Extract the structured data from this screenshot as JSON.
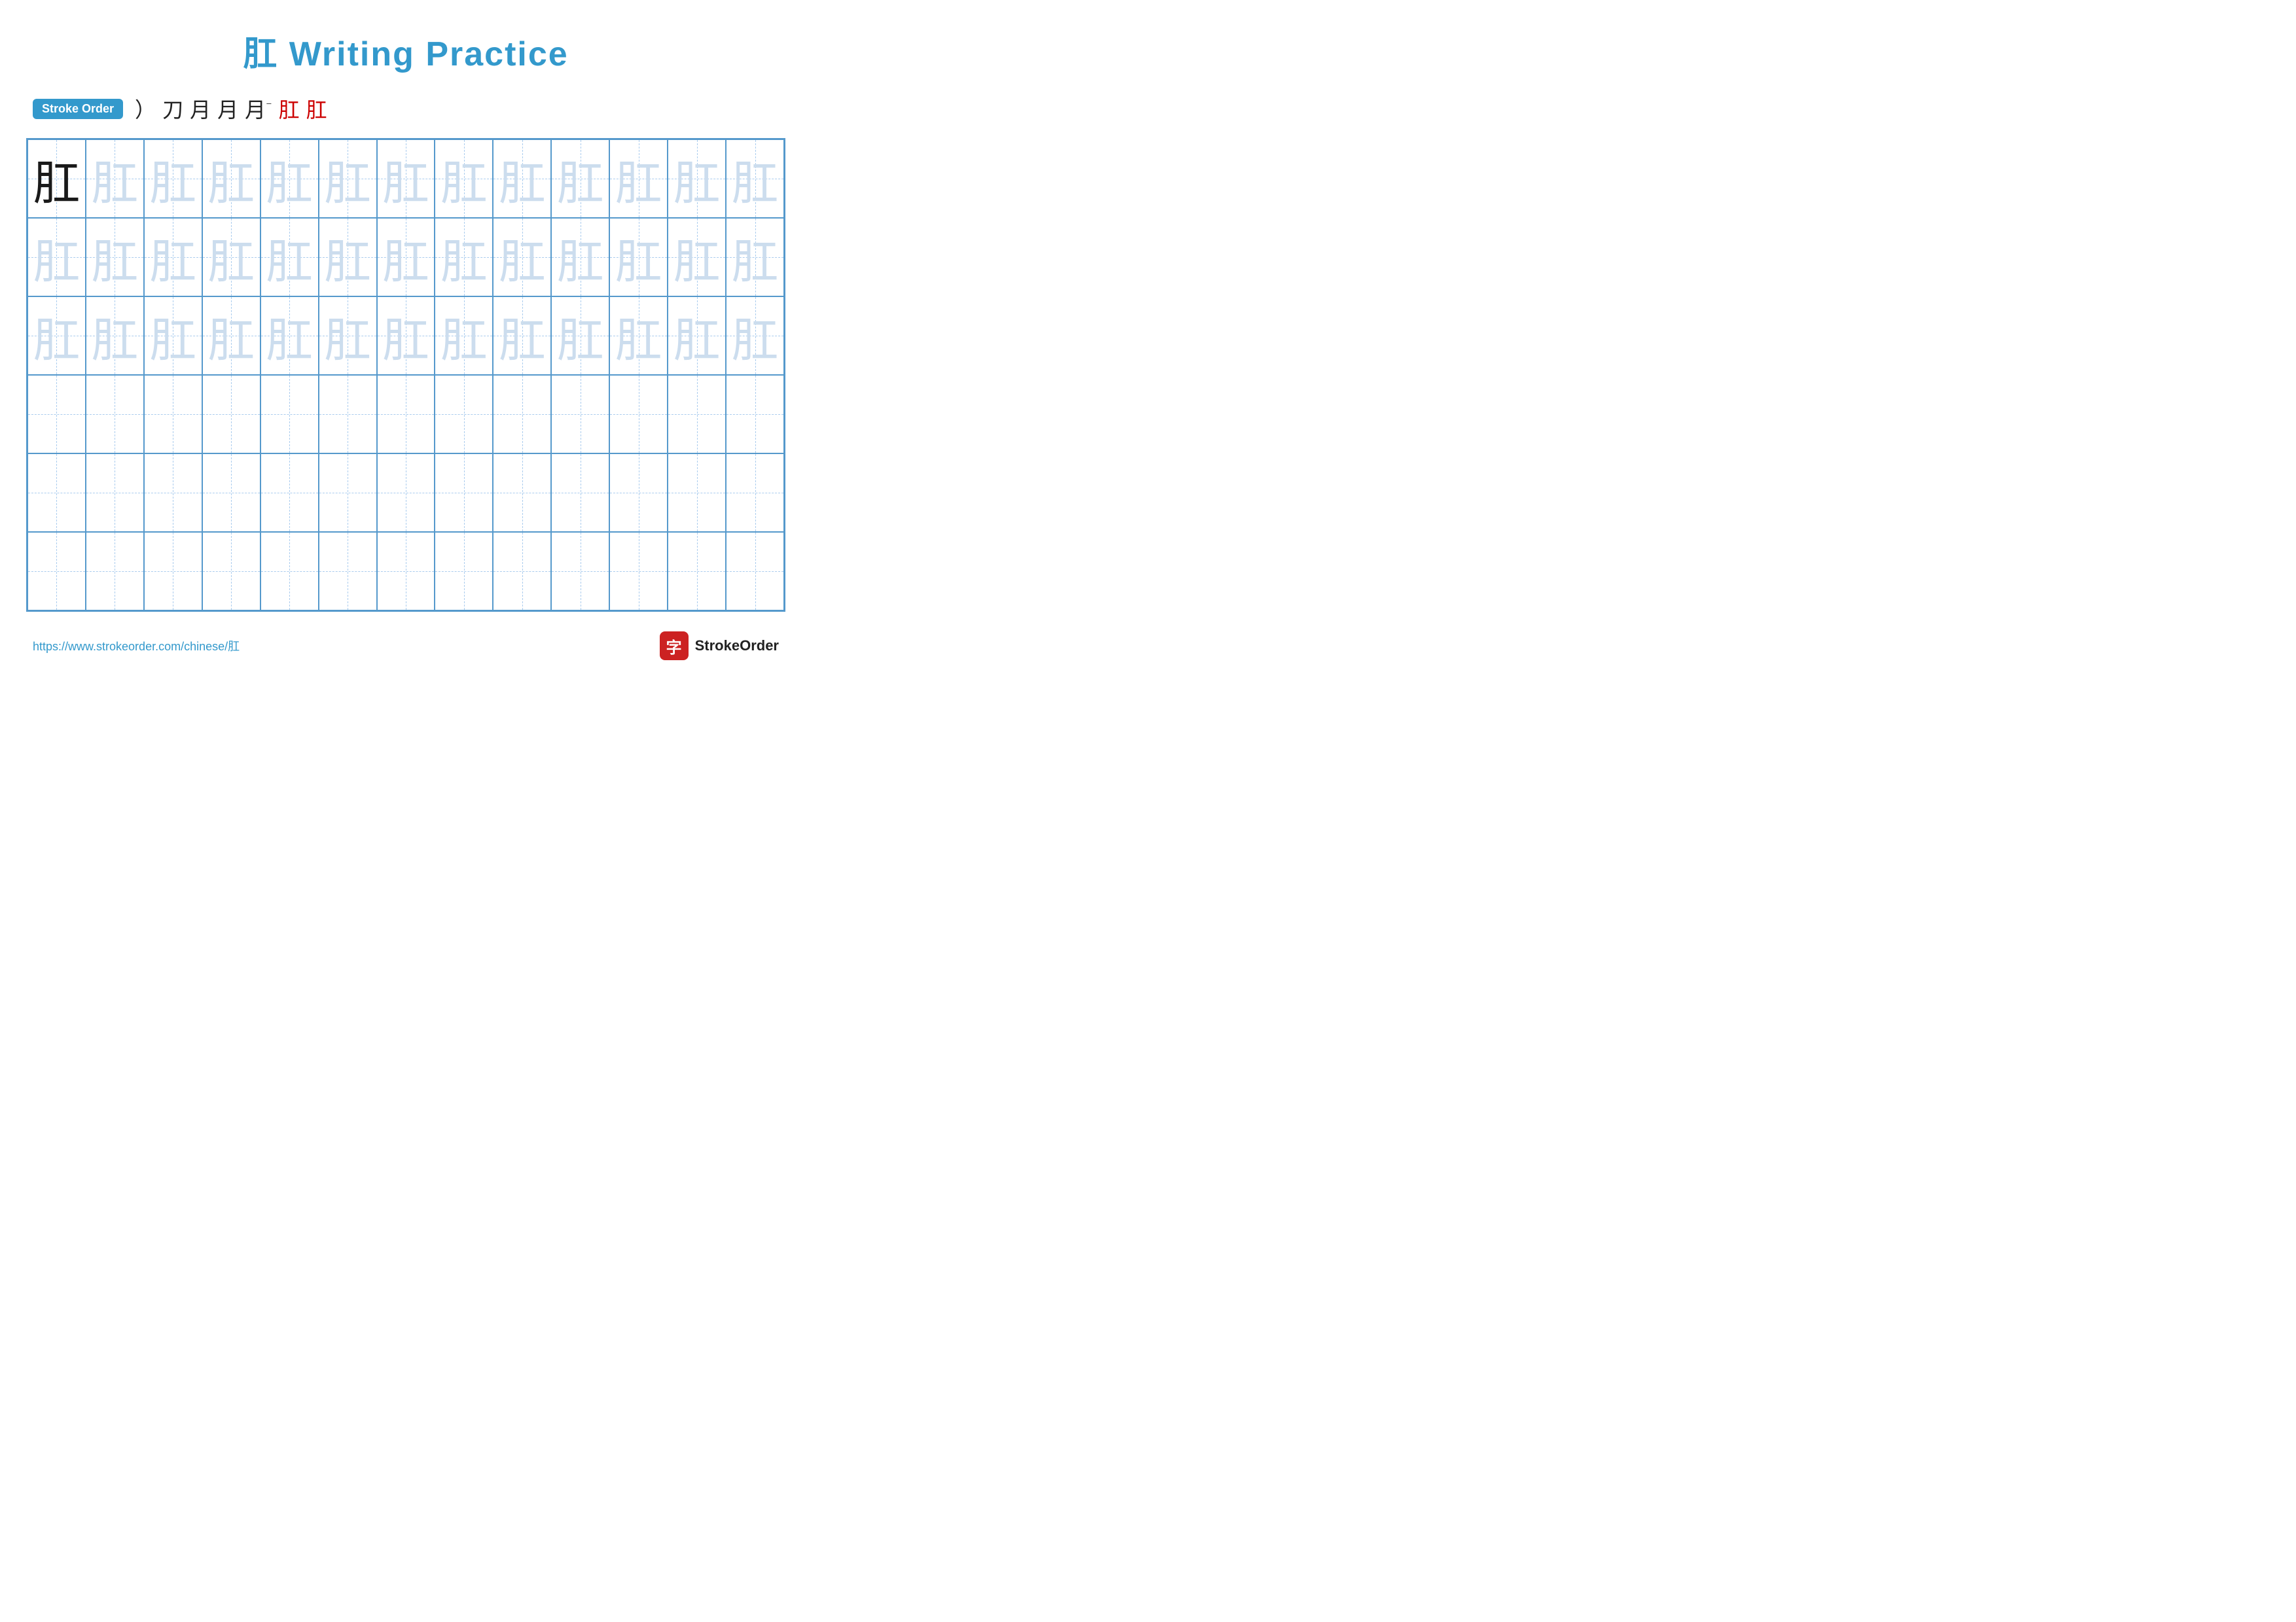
{
  "title": "肛 Writing Practice",
  "stroke_order": {
    "label": "Stroke Order",
    "steps": [
      "）",
      "刀",
      "月",
      "月",
      "月⁻",
      "肛",
      "肛"
    ]
  },
  "character": "肛",
  "grid": {
    "cols": 13,
    "rows": 6,
    "row_types": [
      "dark_then_light",
      "light",
      "light",
      "empty",
      "empty",
      "empty"
    ]
  },
  "footer": {
    "url": "https://www.strokeorder.com/chinese/肛",
    "logo_char": "字",
    "logo_text": "StrokeOrder"
  }
}
